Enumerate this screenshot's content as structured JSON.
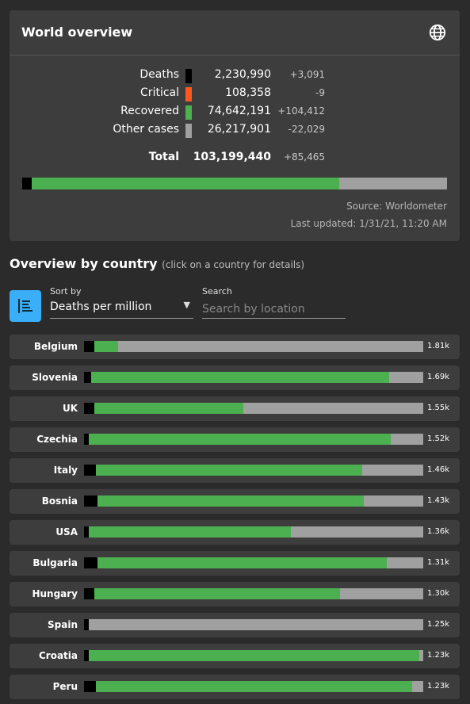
{
  "colors": {
    "deaths": "#000000",
    "critical": "#ff5722",
    "recovered": "#4caf50",
    "other": "#a0a0a0",
    "accent": "#3aaef6"
  },
  "world": {
    "title": "World overview",
    "icon": "globe-icon",
    "stats": [
      {
        "label": "Deaths",
        "value": "2,230,990",
        "delta": "+3,091",
        "color": "#000000"
      },
      {
        "label": "Critical",
        "value": "108,358",
        "delta": "-9",
        "color": "#ff5722"
      },
      {
        "label": "Recovered",
        "value": "74,642,191",
        "delta": "+104,412",
        "color": "#4caf50"
      },
      {
        "label": "Other cases",
        "value": "26,217,901",
        "delta": "-22,029",
        "color": "#a0a0a0"
      }
    ],
    "total": {
      "label": "Total",
      "value": "103,199,440",
      "delta": "+85,465"
    },
    "bar_shares": [
      2.16,
      0.1,
      72.33,
      25.41
    ],
    "source": "Source: Worldometer",
    "updated": "Last updated: 1/31/21, 11:20 AM"
  },
  "countries_section": {
    "title": "Overview by country",
    "hint": "(click on a country for details)",
    "sort_icon": "sort-list-icon",
    "sort_label": "Sort by",
    "sort_value": "Deaths per million",
    "search_label": "Search",
    "search_placeholder": "Search by location",
    "search_value": ""
  },
  "countries": [
    {
      "name": "Belgium",
      "value": "1.81k",
      "deaths": 3,
      "recovered": 7,
      "other": 90
    },
    {
      "name": "Slovenia",
      "value": "1.69k",
      "deaths": 2,
      "recovered": 88,
      "other": 10
    },
    {
      "name": "UK",
      "value": "1.55k",
      "deaths": 3,
      "recovered": 44,
      "other": 53
    },
    {
      "name": "Czechia",
      "value": "1.52k",
      "deaths": 1.5,
      "recovered": 88.9,
      "other": 9.6
    },
    {
      "name": "Italy",
      "value": "1.46k",
      "deaths": 3.5,
      "recovered": 78.5,
      "other": 18
    },
    {
      "name": "Bosnia",
      "value": "1.43k",
      "deaths": 4,
      "recovered": 78.5,
      "other": 17.5
    },
    {
      "name": "USA",
      "value": "1.36k",
      "deaths": 1.5,
      "recovered": 59.6,
      "other": 38.9
    },
    {
      "name": "Bulgaria",
      "value": "1.31k",
      "deaths": 4,
      "recovered": 85.3,
      "other": 10.7
    },
    {
      "name": "Hungary",
      "value": "1.30k",
      "deaths": 3,
      "recovered": 72.4,
      "other": 24.6
    },
    {
      "name": "Spain",
      "value": "1.25k",
      "deaths": 1.5,
      "recovered": 0,
      "other": 98.5
    },
    {
      "name": "Croatia",
      "value": "1.23k",
      "deaths": 1.5,
      "recovered": 97.3,
      "other": 1.2
    },
    {
      "name": "Peru",
      "value": "1.23k",
      "deaths": 3.5,
      "recovered": 93.2,
      "other": 3.3
    }
  ]
}
